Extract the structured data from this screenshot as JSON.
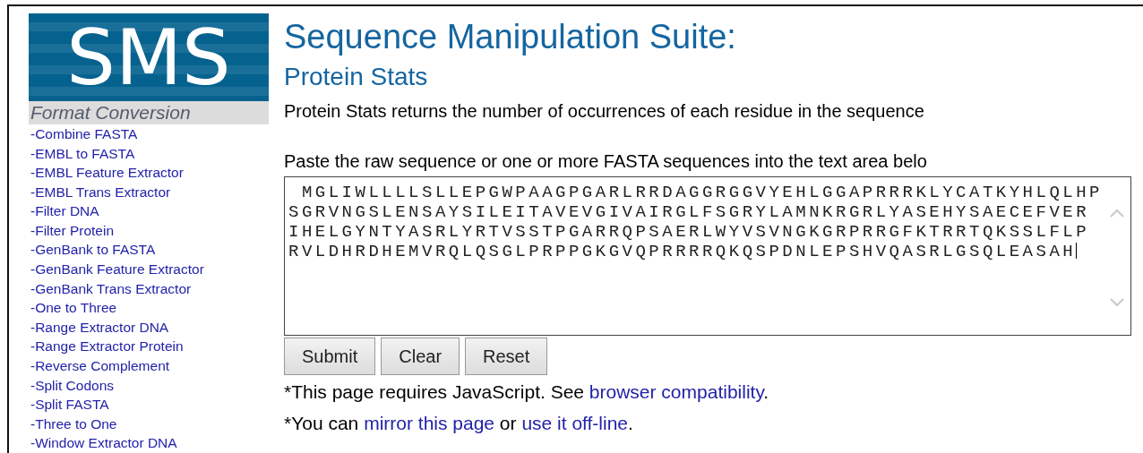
{
  "logo": {
    "text": "SMS"
  },
  "sidebar": {
    "heading": "Format Conversion",
    "items": [
      "-Combine FASTA",
      "-EMBL to FASTA",
      "-EMBL Feature Extractor",
      "-EMBL Trans Extractor",
      "-Filter DNA",
      "-Filter Protein",
      "-GenBank to FASTA",
      "-GenBank Feature Extractor",
      "-GenBank Trans Extractor",
      "-One to Three",
      "-Range Extractor DNA",
      "-Range Extractor Protein",
      "-Reverse Complement",
      "-Split Codons",
      "-Split FASTA",
      "-Three to One",
      "-Window Extractor DNA"
    ]
  },
  "title": "Sequence Manipulation Suite:",
  "subtitle": "Protein Stats",
  "description": "Protein Stats returns the number of occurrences of each residue in the sequence",
  "instruction": "Paste the raw sequence or one or more FASTA sequences into the text area belo",
  "sequence_field": {
    "value": " MGLIWLLLLSLLEPGWPAAGPGARLRRDAGGRGGVYEHLGGAPRRRKLYCATKYHLQLHP\nSGRVNGSLENSAYSILEITAVEVGIVAIRGLFSGRYLAMNKRGRLYASEHYSAECEFVER\nIHELGYNTYASRLYRTVSSTPGARRQPSAERLWYVSVNGKGRPRRGFKTRRTQKSSLFLP\nRVLDHRDHEMVRQLQSGLPRPPGKGVQPRRRRQKQSPDNLEPSHVQASRLGSQLEASAH"
  },
  "buttons": [
    "Submit",
    "Clear",
    "Reset"
  ],
  "notes": [
    {
      "parts": [
        {
          "kind": "text",
          "text": "*This page requires JavaScript. See "
        },
        {
          "kind": "link",
          "text": "browser compatibility"
        },
        {
          "kind": "text",
          "text": "."
        }
      ]
    },
    {
      "parts": [
        {
          "kind": "text",
          "text": "*You can "
        },
        {
          "kind": "link",
          "text": "mirror this page"
        },
        {
          "kind": "text",
          "text": " or "
        },
        {
          "kind": "link",
          "text": "use it off-line"
        },
        {
          "kind": "text",
          "text": "."
        }
      ]
    }
  ]
}
